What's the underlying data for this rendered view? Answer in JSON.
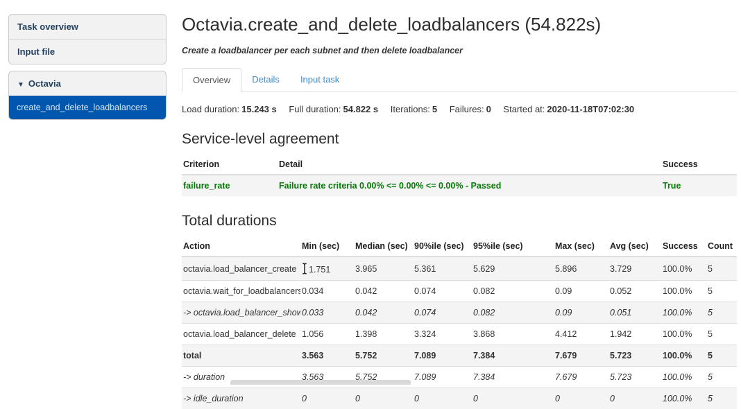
{
  "colors": {
    "accent_blue": "#0057ad",
    "link_blue": "#428bca",
    "success_green": "#067a06"
  },
  "sidebar": {
    "items": [
      {
        "label": "Task overview"
      },
      {
        "label": "Input file"
      }
    ],
    "group": {
      "icon": "▼",
      "label": "Octavia"
    },
    "selected_item": "create_and_delete_loadbalancers"
  },
  "header": {
    "title": "Octavia.create_and_delete_loadbalancers (54.822s)",
    "subtitle": "Create a loadbalancer per each subnet and then delete loadbalancer"
  },
  "tabs": [
    {
      "label": "Overview",
      "active": true
    },
    {
      "label": "Details",
      "active": false
    },
    {
      "label": "Input task",
      "active": false
    }
  ],
  "stats": [
    {
      "label": "Load duration:",
      "value": "15.243 s"
    },
    {
      "label": "Full duration:",
      "value": "54.822 s"
    },
    {
      "label": "Iterations:",
      "value": "5"
    },
    {
      "label": "Failures:",
      "value": "0"
    },
    {
      "label": "Started at:",
      "value": "2020-11-18T07:02:30"
    }
  ],
  "sla": {
    "heading": "Service-level agreement",
    "columns": [
      "Criterion",
      "Detail",
      "Success"
    ],
    "rows": [
      {
        "criterion": "failure_rate",
        "detail": "Failure rate criteria 0.00% <= 0.00% <= 0.00% - Passed",
        "success": "True"
      }
    ]
  },
  "durations": {
    "heading": "Total durations",
    "columns": [
      "Action",
      "Min (sec)",
      "Median (sec)",
      "90%ile (sec)",
      "95%ile (sec)",
      "Max (sec)",
      "Avg (sec)",
      "Success",
      "Count"
    ],
    "rows": [
      {
        "action": "octavia.load_balancer_create",
        "values": [
          "1.751",
          "3.965",
          "5.361",
          "5.629",
          "5.896",
          "3.729",
          "100.0%",
          "5"
        ],
        "style": "normal",
        "cursor": true
      },
      {
        "action": "octavia.wait_for_loadbalancers",
        "values": [
          "0.034",
          "0.042",
          "0.074",
          "0.082",
          "0.09",
          "0.052",
          "100.0%",
          "5"
        ],
        "style": "normal"
      },
      {
        "action": "-> octavia.load_balancer_show",
        "values": [
          "0.033",
          "0.042",
          "0.074",
          "0.082",
          "0.09",
          "0.051",
          "100.0%",
          "5"
        ],
        "style": "italic"
      },
      {
        "action": "octavia.load_balancer_delete",
        "values": [
          "1.056",
          "1.398",
          "3.324",
          "3.868",
          "4.412",
          "1.942",
          "100.0%",
          "5"
        ],
        "style": "normal"
      },
      {
        "action": "total",
        "values": [
          "3.563",
          "5.752",
          "7.089",
          "7.384",
          "7.679",
          "5.723",
          "100.0%",
          "5"
        ],
        "style": "bold"
      },
      {
        "action": "-> duration",
        "values": [
          "3.563",
          "5.752",
          "7.089",
          "7.384",
          "7.679",
          "5.723",
          "100.0%",
          "5"
        ],
        "style": "italic"
      },
      {
        "action": "-> idle_duration",
        "values": [
          "0",
          "0",
          "0",
          "0",
          "0",
          "0",
          "100.0%",
          "5"
        ],
        "style": "italic"
      }
    ]
  }
}
